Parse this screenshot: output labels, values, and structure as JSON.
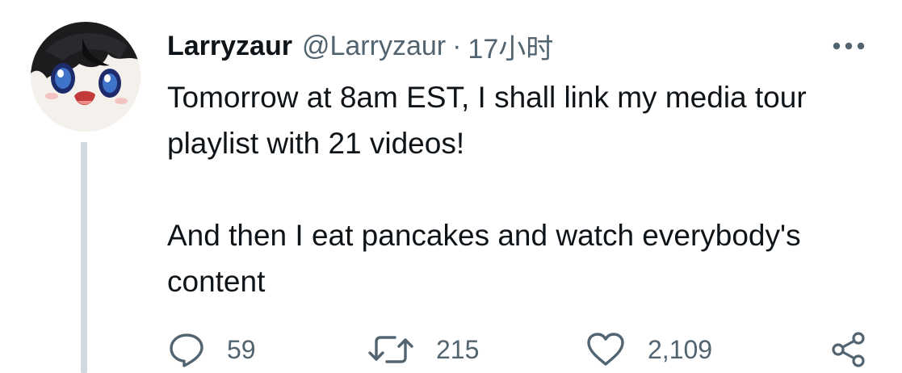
{
  "tweet": {
    "display_name": "Larryzaur",
    "handle": "@Larryzaur",
    "separator": "·",
    "time": "17小时",
    "paragraphs": [
      "Tomorrow at 8am EST, I shall link my media tour playlist with 21 videos!",
      "And then I eat pancakes and watch everybody's content"
    ]
  },
  "actions": {
    "reply": {
      "icon": "reply-icon",
      "count": "59"
    },
    "retweet": {
      "icon": "retweet-icon",
      "count": "215"
    },
    "like": {
      "icon": "heart-icon",
      "count": "2,109"
    },
    "share": {
      "icon": "share-icon"
    }
  },
  "colors": {
    "text": "#0f1419",
    "secondary": "#536471",
    "thread_line": "#cfd9de"
  }
}
